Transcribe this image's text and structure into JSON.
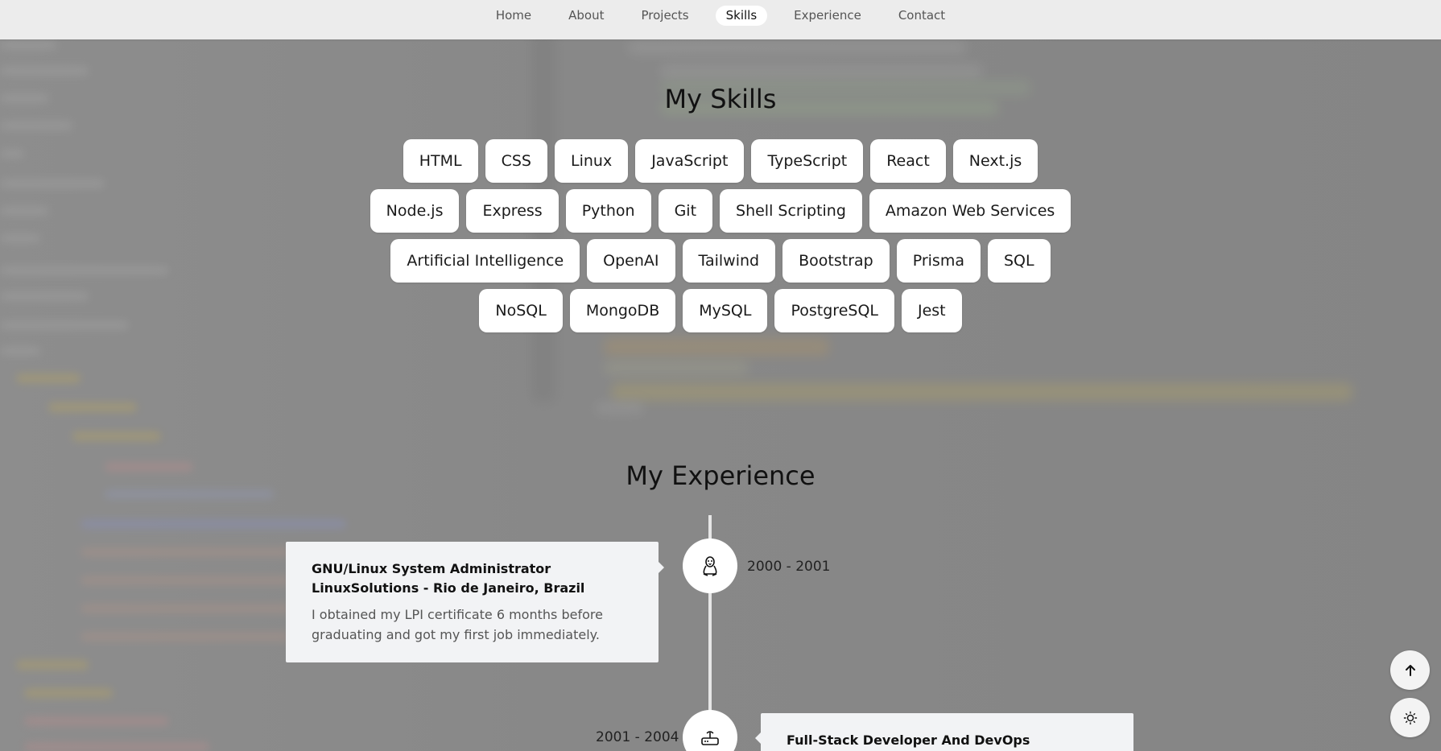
{
  "nav": {
    "items": [
      {
        "label": "Home",
        "active": false
      },
      {
        "label": "About",
        "active": false
      },
      {
        "label": "Projects",
        "active": false
      },
      {
        "label": "Skills",
        "active": true
      },
      {
        "label": "Experience",
        "active": false
      },
      {
        "label": "Contact",
        "active": false
      }
    ]
  },
  "skills": {
    "title": "My Skills",
    "rows": [
      [
        "HTML",
        "CSS",
        "Linux",
        "JavaScript",
        "TypeScript",
        "React",
        "Next.js"
      ],
      [
        "Node.js",
        "Express",
        "Python",
        "Git",
        "Shell Scripting",
        "Amazon Web Services"
      ],
      [
        "Artificial Intelligence",
        "OpenAI",
        "Tailwind",
        "Bootstrap",
        "Prisma",
        "SQL"
      ],
      [
        "NoSQL",
        "MongoDB",
        "MySQL",
        "PostgreSQL",
        "Jest"
      ]
    ]
  },
  "experience": {
    "title": "My Experience",
    "items": [
      {
        "title": "GNU/Linux System Administrator",
        "location": "LinuxSolutions - Rio de Janeiro, Brazil",
        "description": "I obtained my LPI certificate 6 months before graduating and got my first job immediately.",
        "date": "2000 - 2001",
        "icon": "linux-penguin-icon"
      },
      {
        "title": "Full-Stack Developer And DevOps",
        "date": "2001 - 2004",
        "icon": "router-icon"
      }
    ]
  },
  "floating": {
    "scroll_top_icon": "arrow-up-icon",
    "theme_icon": "sun-icon"
  },
  "colors": {
    "navbar_bg": "#ececec",
    "card_bg": "#f2f3f5",
    "chip_bg": "#ffffff",
    "page_overlay": "#8a8a8a"
  }
}
